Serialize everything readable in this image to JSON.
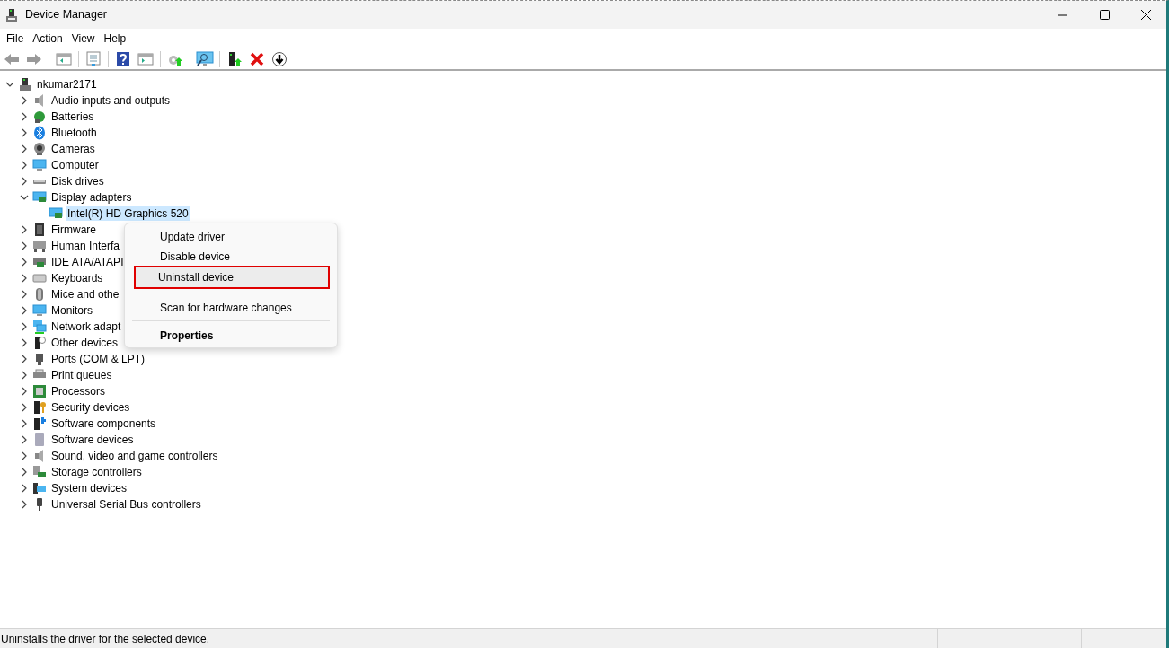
{
  "window": {
    "title": "Device Manager"
  },
  "menu_bar": [
    "File",
    "Action",
    "View",
    "Help"
  ],
  "tree": {
    "label": "nkumar2171",
    "expanded": true,
    "children": [
      {
        "label": "Audio inputs and outputs",
        "expanded": false
      },
      {
        "label": "Batteries",
        "expanded": false
      },
      {
        "label": "Bluetooth",
        "expanded": false
      },
      {
        "label": "Cameras",
        "expanded": false
      },
      {
        "label": "Computer",
        "expanded": false
      },
      {
        "label": "Disk drives",
        "expanded": false
      },
      {
        "label": "Display adapters",
        "expanded": true,
        "children": [
          {
            "label": "Intel(R) HD Graphics 520",
            "selected": true
          }
        ]
      },
      {
        "label": "Firmware",
        "expanded": false
      },
      {
        "label": "Human Interfa",
        "expanded": false
      },
      {
        "label": "IDE ATA/ATAPI",
        "expanded": false
      },
      {
        "label": "Keyboards",
        "expanded": false
      },
      {
        "label": "Mice and othe",
        "expanded": false
      },
      {
        "label": "Monitors",
        "expanded": false
      },
      {
        "label": "Network adapt",
        "expanded": false
      },
      {
        "label": "Other devices",
        "expanded": false
      },
      {
        "label": "Ports (COM & LPT)",
        "expanded": false
      },
      {
        "label": "Print queues",
        "expanded": false
      },
      {
        "label": "Processors",
        "expanded": false
      },
      {
        "label": "Security devices",
        "expanded": false
      },
      {
        "label": "Software components",
        "expanded": false
      },
      {
        "label": "Software devices",
        "expanded": false
      },
      {
        "label": "Sound, video and game controllers",
        "expanded": false
      },
      {
        "label": "Storage controllers",
        "expanded": false
      },
      {
        "label": "System devices",
        "expanded": false
      },
      {
        "label": "Universal Serial Bus controllers",
        "expanded": false
      }
    ]
  },
  "context_menu": [
    {
      "kind": "item",
      "label": "Update driver",
      "selected": false
    },
    {
      "kind": "item",
      "label": "Disable device",
      "selected": false
    },
    {
      "kind": "item",
      "label": "Uninstall device",
      "selected": true
    },
    {
      "kind": "separator"
    },
    {
      "kind": "item",
      "label": "Scan for hardware changes",
      "selected": false
    },
    {
      "kind": "separator"
    },
    {
      "kind": "default",
      "label": "Properties",
      "selected": false
    }
  ],
  "status_bar": {
    "text": "Uninstalls the driver for the selected device."
  }
}
